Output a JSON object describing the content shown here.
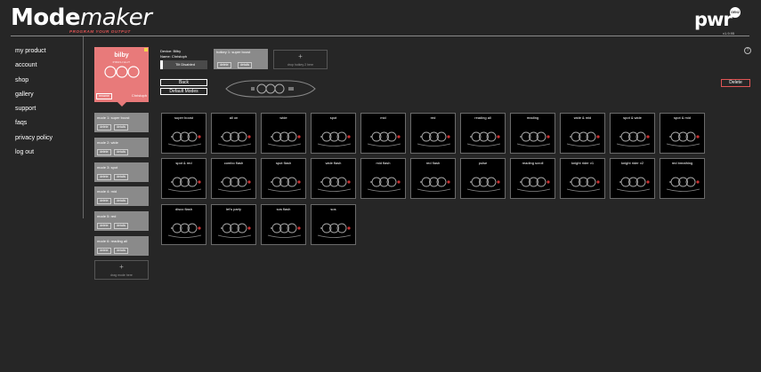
{
  "brand": {
    "logo_bold": "Mode",
    "logo_italic": "maker",
    "tagline": "PROGRAM YOUR OUTPUT",
    "pwr": "pwr",
    "pwr_badge": "GEN2",
    "version": "v1.9.95"
  },
  "nav": [
    "my product",
    "account",
    "shop",
    "gallery",
    "support",
    "faqs",
    "privacy policy",
    "log out"
  ],
  "device": {
    "name": "bilby",
    "subtitle": "PWRLIGHT",
    "rename_label": "rename",
    "owner": "Christoph",
    "info_device": "Device: Bilby",
    "info_name": "Name: Christoph",
    "tilt": "Tilt Disabled"
  },
  "hotkey": {
    "label": "hotkey 1: super boost",
    "delete": "delete",
    "details": "details",
    "drop_text": "drop hotkey 2 here",
    "drop_plus": "+"
  },
  "actions": {
    "back": "Back",
    "default_modes": "Default Modes",
    "delete": "Delete",
    "help": "?"
  },
  "modes": [
    {
      "label": "mode 1: super boost"
    },
    {
      "label": "mode 2: wide"
    },
    {
      "label": "mode 3: spot"
    },
    {
      "label": "mode 4: mid"
    },
    {
      "label": "mode 5: red"
    },
    {
      "label": "mode 6: reading all"
    }
  ],
  "mode_buttons": {
    "delete": "delete",
    "details": "details"
  },
  "mode_drop": {
    "plus": "+",
    "text": "drag mode here"
  },
  "library": [
    "super boost",
    "all on",
    "wide",
    "spot",
    "mid",
    "red",
    "reading all",
    "reading",
    "wide & mid",
    "spot & wide",
    "spot & mid",
    "spot & red",
    "combo flash",
    "spot flash",
    "wide flash",
    "mid flash",
    "red flash",
    "pulse",
    "reading scroll",
    "knight rider v1",
    "knight rider v2",
    "red breathing",
    "disco flash",
    "let's party",
    "sos flash",
    "sos"
  ],
  "colors": {
    "accent": "#e87a7a",
    "alert": "#e05555",
    "background": "#262626",
    "card": "#8a8a8a"
  }
}
